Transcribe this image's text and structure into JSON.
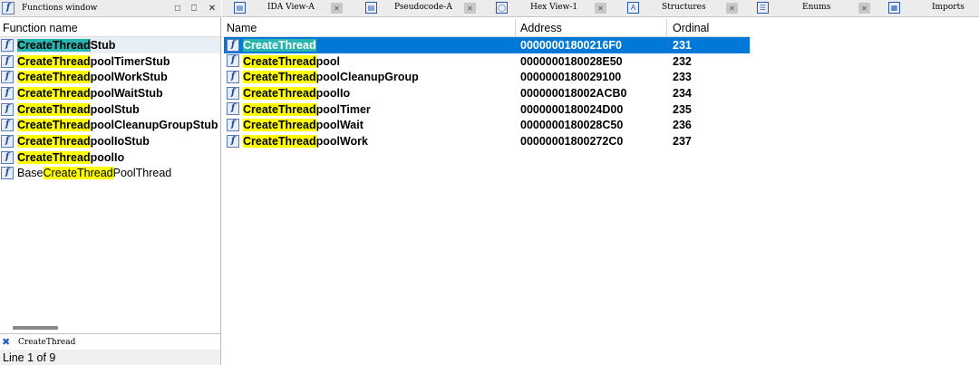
{
  "functions_window": {
    "title": "Functions window",
    "column_header": "Function name",
    "items": [
      {
        "prefix": "",
        "highlight": "CreateThread",
        "suffix": "Stub",
        "bold": true,
        "selected": true
      },
      {
        "prefix": "",
        "highlight": "CreateThread",
        "suffix": "poolTimerStub",
        "bold": true,
        "selected": false
      },
      {
        "prefix": "",
        "highlight": "CreateThread",
        "suffix": "poolWorkStub",
        "bold": true,
        "selected": false
      },
      {
        "prefix": "",
        "highlight": "CreateThread",
        "suffix": "poolWaitStub",
        "bold": true,
        "selected": false
      },
      {
        "prefix": "",
        "highlight": "CreateThread",
        "suffix": "poolStub",
        "bold": true,
        "selected": false
      },
      {
        "prefix": "",
        "highlight": "CreateThread",
        "suffix": "poolCleanupGroupStub",
        "bold": true,
        "selected": false
      },
      {
        "prefix": "",
        "highlight": "CreateThread",
        "suffix": "poolIoStub",
        "bold": true,
        "selected": false
      },
      {
        "prefix": "",
        "highlight": "CreateThread",
        "suffix": "poolIo",
        "bold": true,
        "selected": false
      },
      {
        "prefix": "Base",
        "highlight": "CreateThread",
        "suffix": "PoolThread",
        "bold": false,
        "selected": false
      }
    ],
    "search_text": "CreateThread",
    "status": "Line 1 of 9"
  },
  "tabs": [
    {
      "label": "IDA View-A",
      "icon": "ida-view-icon"
    },
    {
      "label": "Pseudocode-A",
      "icon": "pseudocode-icon"
    },
    {
      "label": "Hex View-1",
      "icon": "hex-view-icon"
    },
    {
      "label": "Structures",
      "icon": "structures-icon"
    },
    {
      "label": "Enums",
      "icon": "enums-icon"
    },
    {
      "label": "Imports",
      "icon": "imports-icon"
    }
  ],
  "exports_table": {
    "columns": [
      "Name",
      "Address",
      "Ordinal"
    ],
    "rows": [
      {
        "highlight": "CreateThread",
        "suffix": "",
        "address": "00000001800216F0",
        "ordinal": "231",
        "selected": true
      },
      {
        "highlight": "CreateThread",
        "suffix": "pool",
        "address": "0000000180028E50",
        "ordinal": "232",
        "selected": false
      },
      {
        "highlight": "CreateThread",
        "suffix": "poolCleanupGroup",
        "address": "0000000180029100",
        "ordinal": "233",
        "selected": false
      },
      {
        "highlight": "CreateThread",
        "suffix": "poolIo",
        "address": "000000018002ACB0",
        "ordinal": "234",
        "selected": false
      },
      {
        "highlight": "CreateThread",
        "suffix": "poolTimer",
        "address": "0000000180024D00",
        "ordinal": "235",
        "selected": false
      },
      {
        "highlight": "CreateThread",
        "suffix": "poolWait",
        "address": "0000000180028C50",
        "ordinal": "236",
        "selected": false
      },
      {
        "highlight": "CreateThread",
        "suffix": "poolWork",
        "address": "00000001800272C0",
        "ordinal": "237",
        "selected": false
      }
    ]
  },
  "colors": {
    "highlight": "#ffff00",
    "selected_highlight": "#2ab4b0",
    "row_selection": "#0078d7"
  }
}
